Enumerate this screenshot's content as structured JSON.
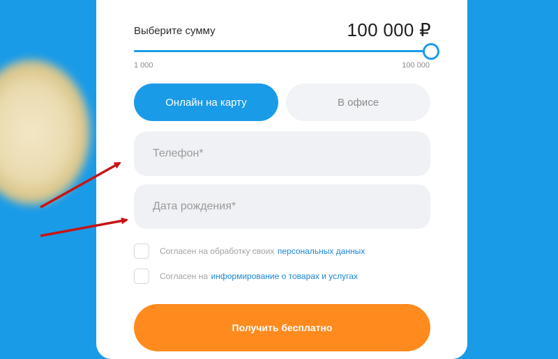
{
  "amount": {
    "label": "Выберите сумму",
    "value": "100 000 ₽",
    "min_label": "1 000",
    "max_label": "100 000",
    "slider_fraction": 1.0
  },
  "tabs": {
    "online": "Онлайн на карту",
    "office": "В офисе",
    "active": "online"
  },
  "fields": {
    "phone_placeholder": "Телефон*",
    "birthdate_placeholder": "Дата рождения*"
  },
  "consents": {
    "personal_prefix": "Согласен на обработку своих ",
    "personal_link": "персональных данных",
    "marketing_prefix": "Согласен на ",
    "marketing_link": "информирование о товарах и услугах"
  },
  "submit_label": "Получить бесплатно",
  "colors": {
    "accent": "#1a9be8",
    "cta": "#ff8a1e",
    "annotation_arrow": "#c81414"
  }
}
